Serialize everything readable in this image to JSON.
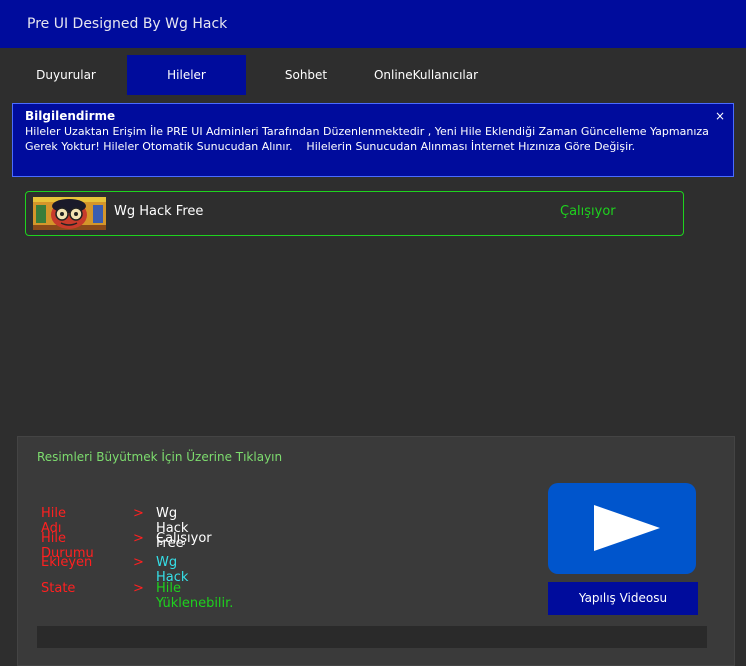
{
  "window": {
    "title": "Pre UI Designed By Wg Hack"
  },
  "tabs": [
    {
      "label": "Duyurular"
    },
    {
      "label": "Hileler"
    },
    {
      "label": "Sohbet"
    },
    {
      "label": "OnlineKullanıcılar"
    }
  ],
  "notice": {
    "title": "Bilgilendirme",
    "body": "Hileler Uzaktan Erişim İle PRE UI Adminleri Tarafından Düzenlenmektedir , Yeni Hile Eklendiği Zaman Güncelleme Yapmanıza Gerek Yoktur! Hileler Otomatik Sunucudan Alınır.    Hilelerin Sunucudan Alınması İnternet Hızınıza Göre Değişir.",
    "close": "×"
  },
  "hacks": [
    {
      "name": "Wg Hack Free",
      "status": "Çalışıyor"
    }
  ],
  "details": {
    "hint": "Resimleri Büyütmek İçin Üzerine Tıklayın",
    "separator": ">",
    "rows": [
      {
        "label": "Hile Adı",
        "value": "Wg Hack Free",
        "color": "#ffffff"
      },
      {
        "label": "Hile Durumu",
        "value": "Çalışıyor",
        "color": "#ffffff"
      },
      {
        "label": "Ekleyen",
        "value": "Wg Hack",
        "color": "#35e0e8"
      },
      {
        "label": "State",
        "value": "Hile Yüklenebilir.",
        "color": "#1ed21e"
      }
    ],
    "video_button": "Yapılış Videosu"
  },
  "colors": {
    "primary": "#000c9c",
    "success": "#1ed21e",
    "label": "#ff2020",
    "play": "#0055cc"
  }
}
